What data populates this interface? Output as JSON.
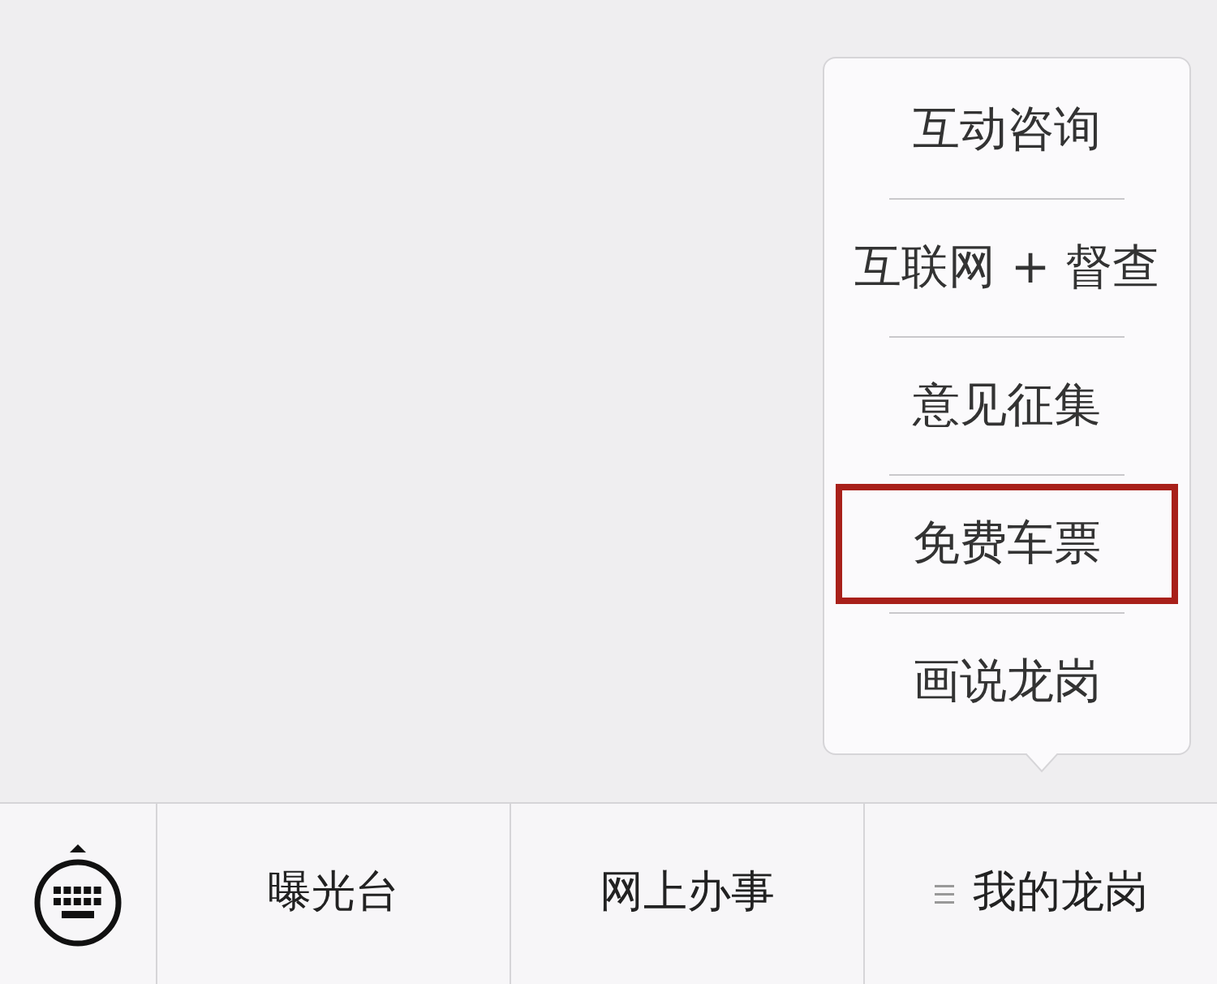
{
  "popup_menu": {
    "items": [
      {
        "label": "互动咨询",
        "highlighted": false
      },
      {
        "label": "互联网 + 督查",
        "highlighted": false
      },
      {
        "label": "意见征集",
        "highlighted": false
      },
      {
        "label": "免费车票",
        "highlighted": true
      },
      {
        "label": "画说龙岗",
        "highlighted": false
      }
    ]
  },
  "bottom_menu": {
    "items": [
      {
        "label": "曝光台",
        "has_submenu": false
      },
      {
        "label": "网上办事",
        "has_submenu": false
      },
      {
        "label": "我的龙岗",
        "has_submenu": true
      }
    ]
  }
}
